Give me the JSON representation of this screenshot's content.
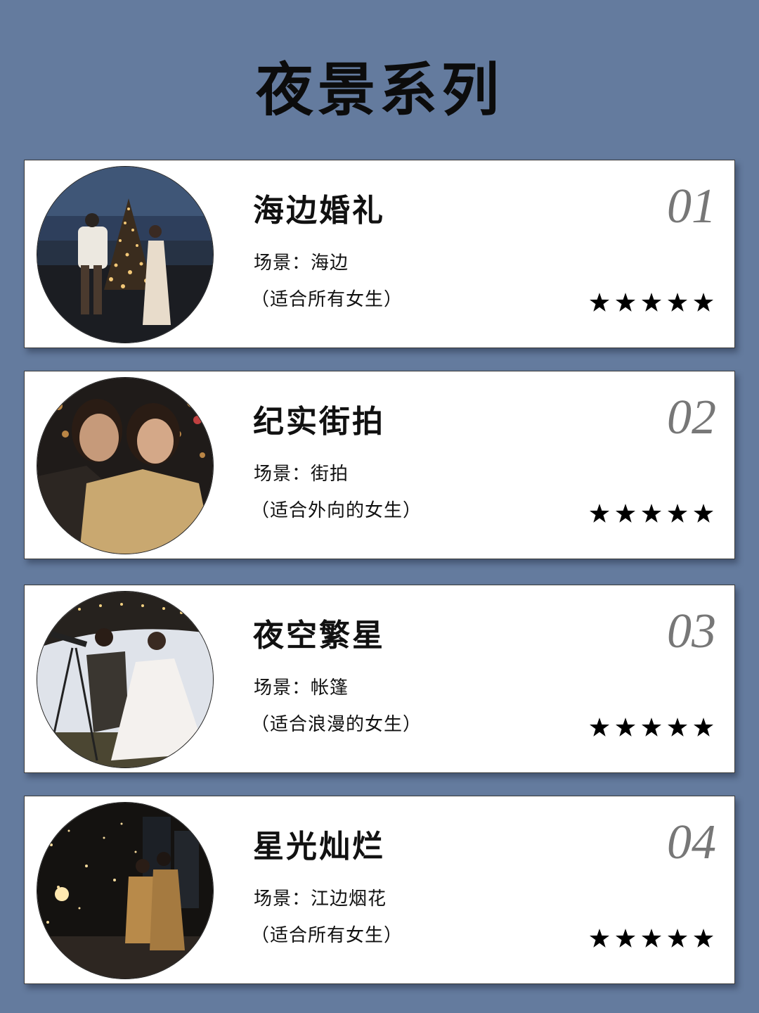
{
  "page": {
    "title": "夜景系列",
    "background": "#647b9e"
  },
  "cards": [
    {
      "number": "01",
      "title": "海边婚礼",
      "scene": "场景：海边",
      "note": "（适合所有女生）",
      "rating": 5,
      "photo": {
        "icon": "seaside-wedding-photo",
        "sky": "#2a3a55",
        "ground": "#1a1d24",
        "accent": "#f0c070"
      }
    },
    {
      "number": "02",
      "title": "纪实街拍",
      "scene": "场景：街拍",
      "note": "（适合外向的女生）",
      "rating": 5,
      "photo": {
        "icon": "street-couple-photo",
        "sky": "#1e1a18",
        "ground": "#6b4a30",
        "accent": "#d8b27a"
      }
    },
    {
      "number": "03",
      "title": "夜空繁星",
      "scene": "场景：帐篷",
      "note": "（适合浪漫的女生）",
      "rating": 5,
      "photo": {
        "icon": "tent-stargazing-photo",
        "sky": "#23201c",
        "ground": "#4a4530",
        "accent": "#f4f0ec"
      }
    },
    {
      "number": "04",
      "title": "星光灿烂",
      "scene": "场景：江边烟花",
      "note": "（适合所有女生）",
      "rating": 5,
      "photo": {
        "icon": "riverside-fireworks-photo",
        "sky": "#141210",
        "ground": "#2b2520",
        "accent": "#f5d79a"
      }
    }
  ]
}
